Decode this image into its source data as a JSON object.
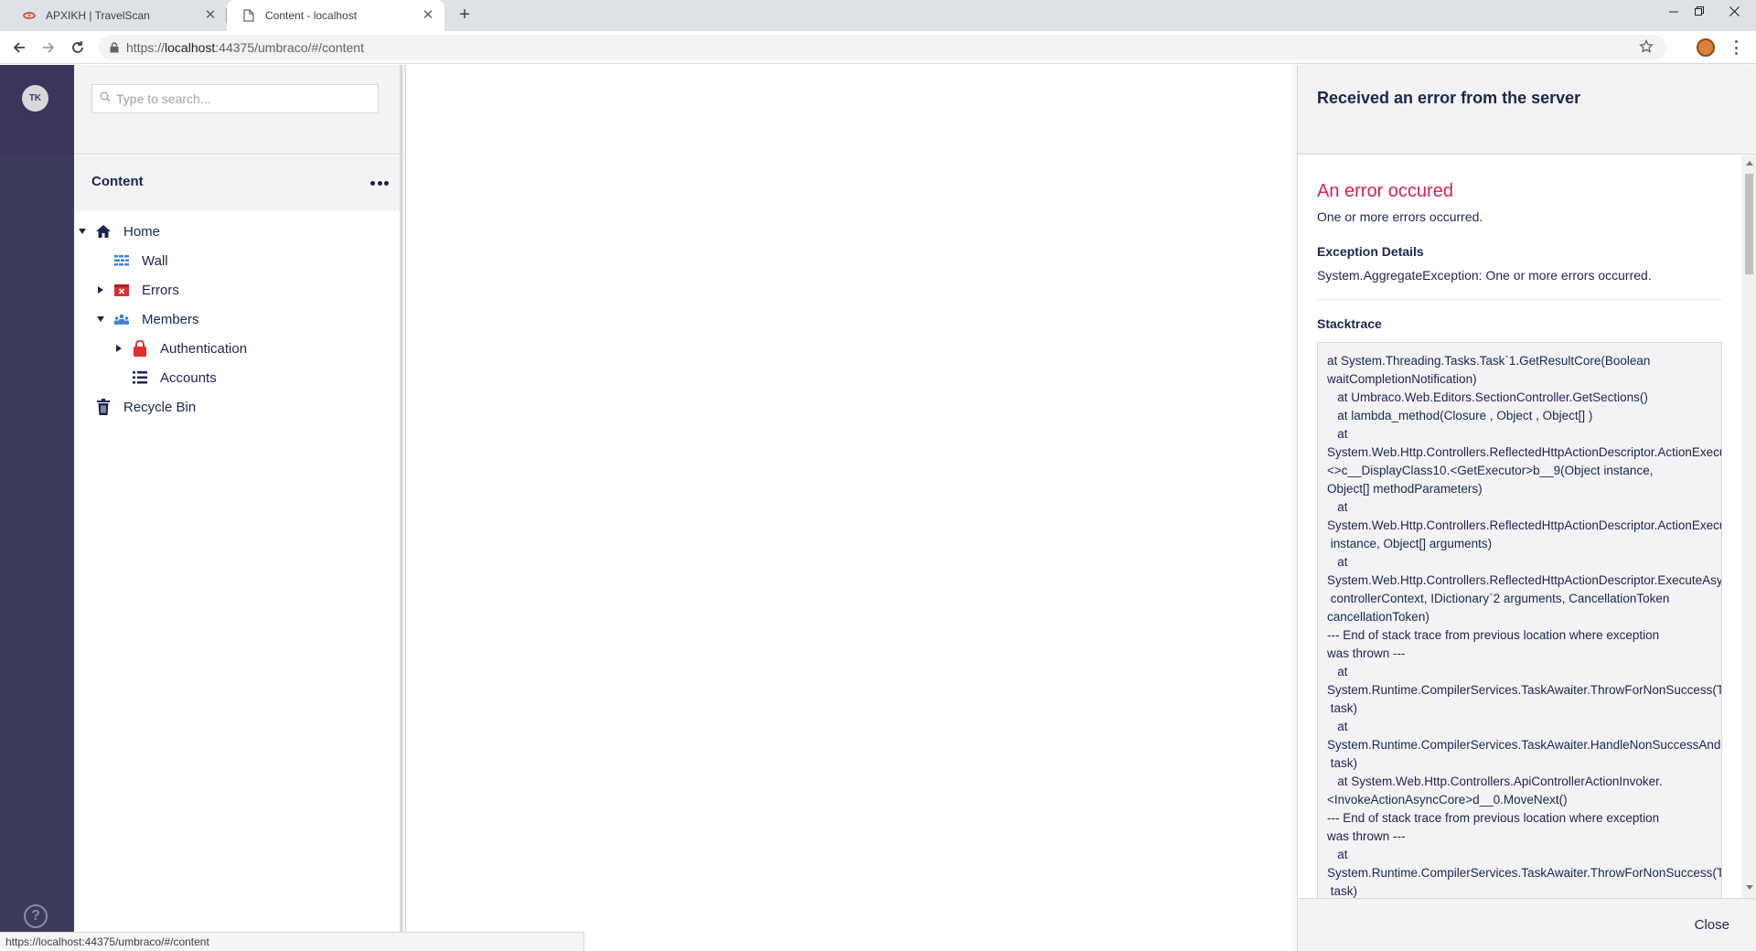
{
  "browser": {
    "tabs": [
      {
        "label": "APXIKH | TravelScan"
      },
      {
        "label": "Content - localhost"
      }
    ],
    "url": {
      "scheme": "https://",
      "host": "localhost",
      "rest": ":44375/umbraco/#/content"
    },
    "status_url": "https://localhost:44375/umbraco/#/content"
  },
  "user": {
    "initials": "TK"
  },
  "help_label": "?",
  "tree": {
    "search_placeholder": "Type to search...",
    "section_title": "Content",
    "nodes": [
      {
        "label": "Home",
        "icon": "home-icon",
        "expanded": true
      },
      {
        "label": "Wall",
        "icon": "grid-icon"
      },
      {
        "label": "Errors",
        "icon": "error-icon"
      },
      {
        "label": "Members",
        "icon": "members-icon",
        "expanded": true
      },
      {
        "label": "Authentication",
        "icon": "lock-icon"
      },
      {
        "label": "Accounts",
        "icon": "list-icon"
      },
      {
        "label": "Recycle Bin",
        "icon": "trash-icon"
      }
    ]
  },
  "error_overlay": {
    "header": "Received an error from the server",
    "error_title": "An error occured",
    "error_message": "One or more errors occurred.",
    "exception_title": "Exception Details",
    "exception_message": "System.AggregateException: One or more errors occurred.",
    "stacktrace_title": "Stacktrace",
    "stacktrace": "at System.Threading.Tasks.Task`1.GetResultCore(Boolean\nwaitCompletionNotification)\n   at Umbraco.Web.Editors.SectionController.GetSections()\n   at lambda_method(Closure , Object , Object[] )\n   at\nSystem.Web.Http.Controllers.ReflectedHttpActionDescriptor.ActionExecutor.\n<>c__DisplayClass10.<GetExecutor>b__9(Object instance,\nObject[] methodParameters)\n   at\nSystem.Web.Http.Controllers.ReflectedHttpActionDescriptor.ActionExecutor.Execute(Object\n instance, Object[] arguments)\n   at\nSystem.Web.Http.Controllers.ReflectedHttpActionDescriptor.ExecuteAsync(HttpControllerContext\n controllerContext, IDictionary`2 arguments, CancellationToken\ncancellationToken)\n--- End of stack trace from previous location where exception\nwas thrown ---\n   at\nSystem.Runtime.CompilerServices.TaskAwaiter.ThrowForNonSuccess(Task\n task)\n   at\nSystem.Runtime.CompilerServices.TaskAwaiter.HandleNonSuccessAndDebuggerNotification(Task\n task)\n   at System.Web.Http.Controllers.ApiControllerActionInvoker.\n<InvokeActionAsyncCore>d__0.MoveNext()\n--- End of stack trace from previous location where exception\nwas thrown ---\n   at\nSystem.Runtime.CompilerServices.TaskAwaiter.ThrowForNonSuccess(Task\n task)",
    "close_label": "Close"
  },
  "colors": {
    "sidebar": "#3d3b5c",
    "error_red": "#d42054",
    "text_primary": "#1b264f",
    "panel_grey": "#f3f3f5"
  }
}
